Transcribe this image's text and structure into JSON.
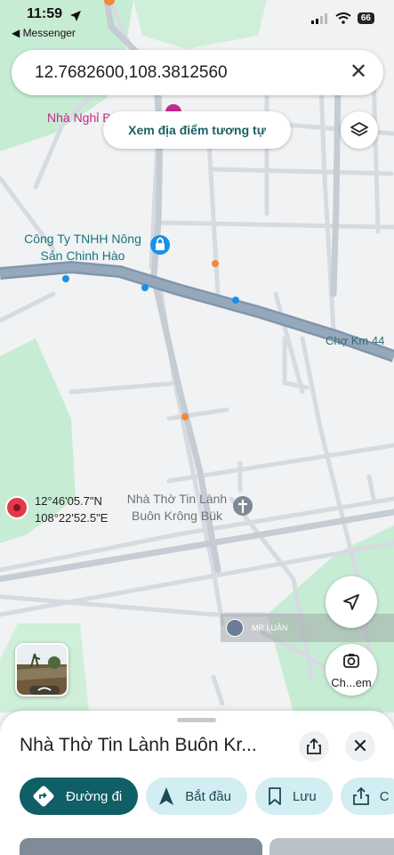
{
  "status_bar": {
    "time": "11:59",
    "back_app": "◀ Messenger",
    "battery": "66"
  },
  "search": {
    "value": "12.7682600,108.3812560"
  },
  "map": {
    "similar_places_button": "Xem địa điểm tương tự",
    "labels": {
      "company": "Công Ty TNHH Nông Sản Chinh Hào",
      "guesthouse": "Nhà Nghỉ B",
      "market": "Chợ Km 44",
      "church": "Nhà Thờ Tin Lành Buôn Krông Bük",
      "pin_lat": "12°46'05.7\"N",
      "pin_lng": "108°22'52.5\"E"
    },
    "lens_button_label": "Ch...em",
    "user_name": "MR LUÂN",
    "colors": {
      "road": "#7e93ab",
      "green": "#c7ecd4",
      "pin": "#e3384b",
      "poi_blue": "#1a90e9"
    }
  },
  "place_sheet": {
    "title": "Nhà Thờ Tin Lành Buôn Kr...",
    "actions": [
      {
        "label": "Đường đi",
        "icon": "directions-icon"
      },
      {
        "label": "Bắt đầu",
        "icon": "navigation-arrow-icon"
      },
      {
        "label": "Lưu",
        "icon": "bookmark-icon"
      },
      {
        "label": "C",
        "icon": "share-icon"
      }
    ]
  }
}
